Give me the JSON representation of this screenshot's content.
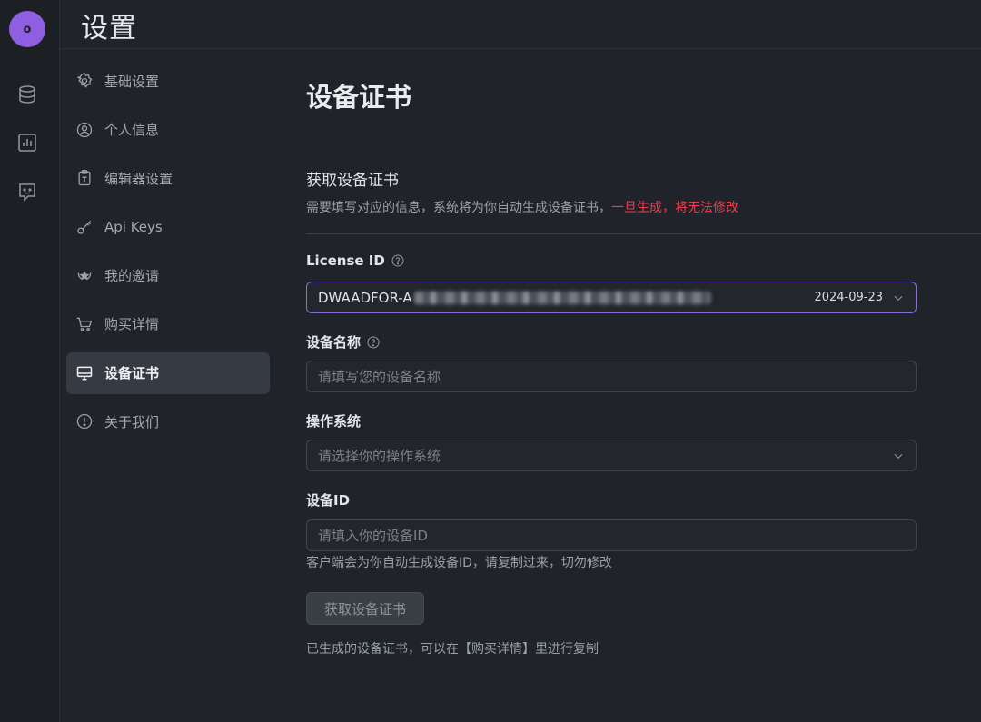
{
  "header": {
    "title": "设置"
  },
  "rail": {
    "avatar_text": "o"
  },
  "nav": {
    "items": [
      {
        "label": "基础设置"
      },
      {
        "label": "个人信息"
      },
      {
        "label": "编辑器设置"
      },
      {
        "label": "Api Keys"
      },
      {
        "label": "我的邀请"
      },
      {
        "label": "购买详情"
      },
      {
        "label": "设备证书"
      },
      {
        "label": "关于我们"
      }
    ]
  },
  "main": {
    "page_title": "设备证书",
    "section_title": "获取设备证书",
    "section_desc": "需要填写对应的信息，系统将为你自动生成设备证书，",
    "section_warn": "一旦生成，将无法修改",
    "license": {
      "label": "License ID",
      "value_prefix": "DWAADFOR-A",
      "date": "2024-09-23"
    },
    "device_name": {
      "label": "设备名称",
      "placeholder": "请填写您的设备名称"
    },
    "os": {
      "label": "操作系统",
      "placeholder": "请选择你的操作系统"
    },
    "device_id": {
      "label": "设备ID",
      "placeholder": "请填入你的设备ID",
      "hint": "客户端会为你自动生成设备ID，请复制过来，切勿修改"
    },
    "submit_label": "获取设备证书",
    "footer_note": "已生成的设备证书，可以在【购买详情】里进行复制"
  },
  "colors": {
    "accent": "#8b6fd6",
    "avatar": "#8e5fe0",
    "warn": "#e8414d"
  }
}
